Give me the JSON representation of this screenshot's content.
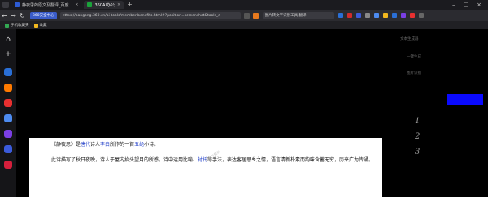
{
  "tabs": [
    {
      "label": "静夜思的原文及翻译_百度...",
      "active": false
    },
    {
      "label": "360AI办公",
      "active": true
    }
  ],
  "toolbar": {
    "badge": "360安全中心",
    "url": "https://bangong.360.cn/ai-tools/member-benefits.html#?position=screenshot&tools_d",
    "search": "图片转文字识别工具 翻译"
  },
  "bookmarks": [
    {
      "label": "手机收藏夹",
      "color": "#33a853"
    },
    {
      "label": "收藏",
      "color": "#f2b81f"
    }
  ],
  "sidebar": {
    "items": [
      {
        "name": "home-icon",
        "glyph": "⌂",
        "color": ""
      },
      {
        "name": "add-icon",
        "glyph": "+",
        "color": ""
      },
      {
        "name": "app-blue-icon",
        "glyph": "",
        "color": "#2a6fd6"
      },
      {
        "name": "app-orange-icon",
        "glyph": "",
        "color": "#ff7a00"
      },
      {
        "name": "app-red-icon",
        "glyph": "",
        "color": "#e83030"
      },
      {
        "name": "app-ring-icon",
        "glyph": "",
        "color": "#4d8bf0"
      },
      {
        "name": "app-purple-icon",
        "glyph": "",
        "color": "#7b3fe4"
      },
      {
        "name": "app-gradient-icon",
        "glyph": "",
        "color": "#3b5bdb"
      },
      {
        "name": "app-game-icon",
        "glyph": "",
        "color": "#d61f3c"
      }
    ]
  },
  "main": {
    "side_text_1": "文本生成器",
    "side_text_2": "一键生成",
    "side_text_3": "图片识别",
    "numbers": [
      "1",
      "2",
      "3"
    ],
    "watermark": "免费下载到",
    "card": {
      "p1": [
        {
          "t": "《静夜思》是",
          "hl": false
        },
        {
          "t": "唐代",
          "hl": true
        },
        {
          "t": "诗人",
          "hl": false
        },
        {
          "t": "李白",
          "hl": true
        },
        {
          "t": "所作的一首",
          "hl": false
        },
        {
          "t": "五绝",
          "hl": true
        },
        {
          "t": "小诗。",
          "hl": false
        }
      ],
      "p2": [
        {
          "t": "此诗描写了秋日夜晚，诗人于屋内抬头望月的所感。诗中运用比喻、",
          "hl": false
        },
        {
          "t": "衬托",
          "hl": true
        },
        {
          "t": "等手法，表达客居思乡之情，语言清新朴素而韵味含蓄无穷，历来广为传诵。",
          "hl": false
        }
      ]
    }
  }
}
